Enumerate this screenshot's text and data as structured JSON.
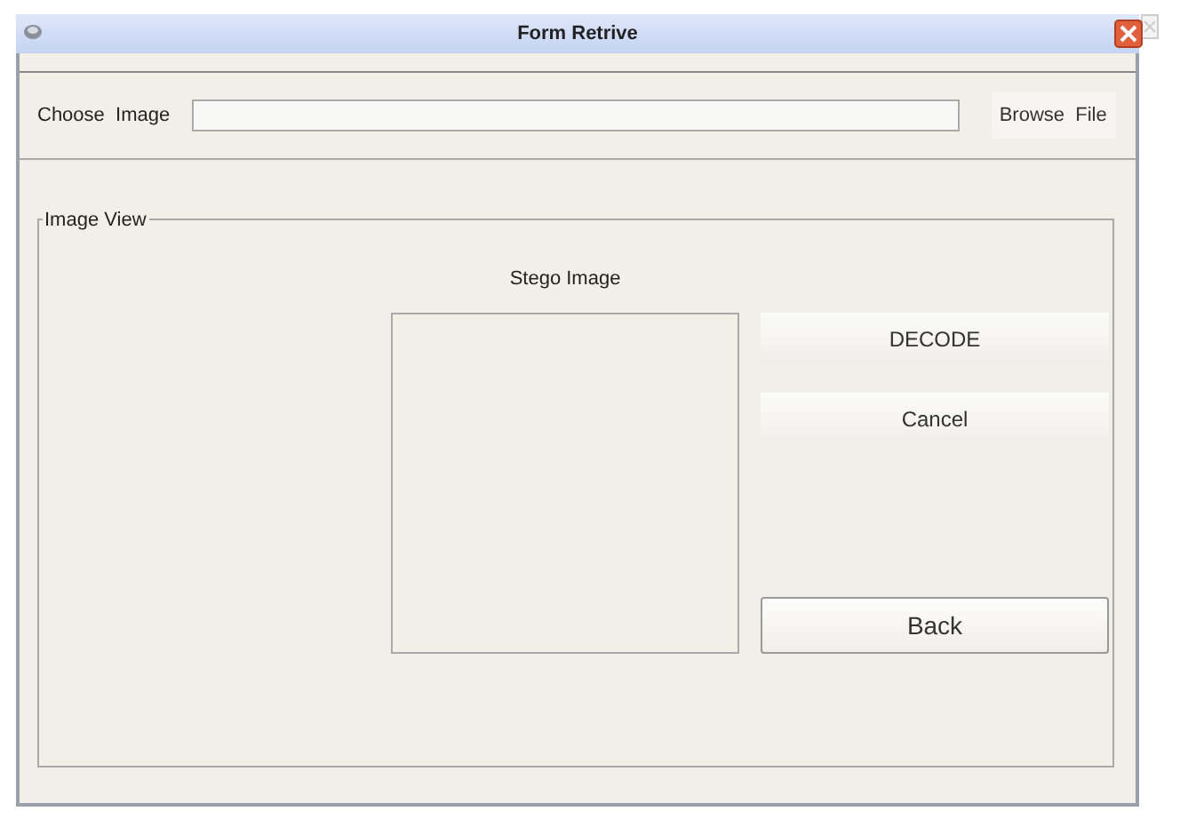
{
  "window": {
    "title": "Form Retrive"
  },
  "file_row": {
    "label": "Choose  Image",
    "browse_button": "Browse  File"
  },
  "image_view": {
    "title": "Image View",
    "image_label": "Stego Image",
    "buttons": [
      {
        "label": "DECODE",
        "kind": "flat"
      },
      {
        "label": "Cancel",
        "kind": "flat"
      },
      {
        "label": "Back",
        "kind": "bordered"
      }
    ]
  }
}
